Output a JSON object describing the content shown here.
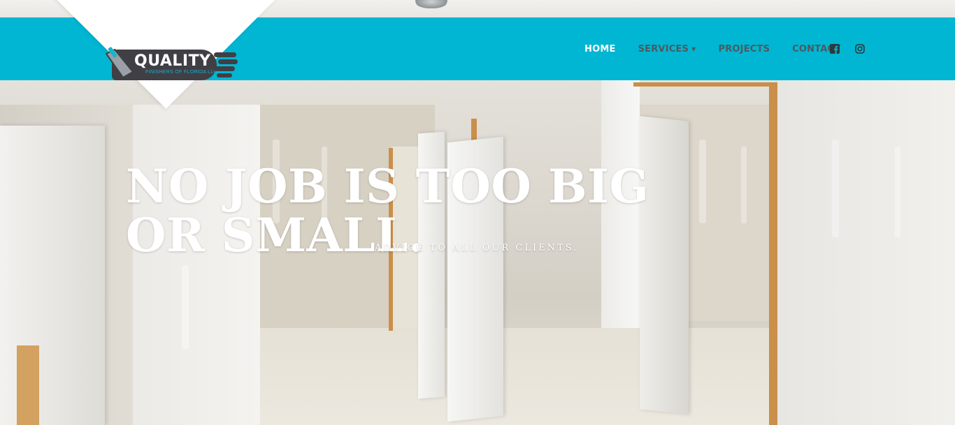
{
  "brand": {
    "name": "QUALITY",
    "tagline": "FINISHERS OF FLORIDA LLC",
    "primary_color": "#00b6d2",
    "logo_dark_color": "#3f3f45"
  },
  "nav": {
    "items": [
      {
        "label": "HOME",
        "active": true
      },
      {
        "label": "SERVICES",
        "has_dropdown": true
      },
      {
        "label": "PROJECTS"
      },
      {
        "label": "CONTACT"
      }
    ],
    "social": [
      {
        "icon": "facebook-icon"
      },
      {
        "icon": "instagram-icon"
      }
    ]
  },
  "hero": {
    "headline": "NO JOB IS TOO BIG OR SMALL.",
    "subline": "ADVICE TO ALL OUR CLIENTS."
  }
}
